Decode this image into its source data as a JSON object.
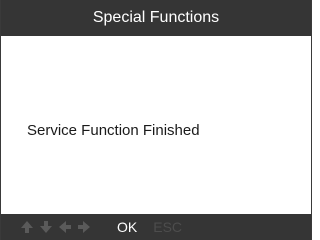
{
  "header": {
    "title": "Special Functions"
  },
  "main": {
    "message": "Service Function Finished"
  },
  "footer": {
    "nav_icons": [
      "arrow-up-icon",
      "arrow-down-icon",
      "arrow-left-icon",
      "arrow-right-icon"
    ],
    "ok_label": "OK",
    "esc_label": "ESC"
  },
  "colors": {
    "bar_background": "#353535",
    "title_text": "#ffffff",
    "esc_disabled": "#4d4d4d"
  }
}
